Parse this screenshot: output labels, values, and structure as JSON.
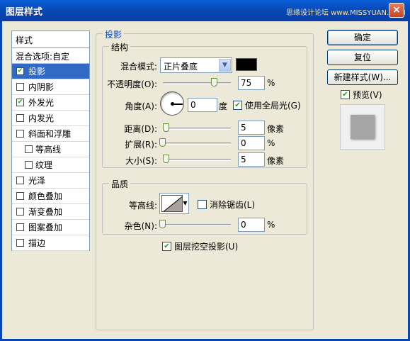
{
  "window": {
    "title": "图层样式",
    "watermark": "思缘设计论坛 www.MISSYUAN.COM",
    "close_glyph": "×"
  },
  "sidebar": {
    "header": "样式",
    "blend_options": "混合选项:自定",
    "items": [
      {
        "label": "投影",
        "checked": true,
        "selected": true
      },
      {
        "label": "内阴影",
        "checked": false
      },
      {
        "label": "外发光",
        "checked": true
      },
      {
        "label": "内发光",
        "checked": false
      },
      {
        "label": "斜面和浮雕",
        "checked": false
      },
      {
        "label": "等高线",
        "checked": false,
        "sub": true
      },
      {
        "label": "纹理",
        "checked": false,
        "sub": true
      },
      {
        "label": "光泽",
        "checked": false
      },
      {
        "label": "颜色叠加",
        "checked": false
      },
      {
        "label": "渐变叠加",
        "checked": false
      },
      {
        "label": "图案叠加",
        "checked": false
      },
      {
        "label": "描边",
        "checked": false
      }
    ]
  },
  "drop_shadow": {
    "title": "投影",
    "structure": {
      "title": "结构",
      "blend_mode_label": "混合模式:",
      "blend_mode_value": "正片叠底",
      "shadow_color": "#000000",
      "opacity_label": "不透明度(O):",
      "opacity_value": "75",
      "opacity_unit": "%",
      "opacity_level": 0.75,
      "angle_label": "角度(A):",
      "angle_value": "0",
      "angle_unit": "度",
      "global_light_label": "使用全局光(G)",
      "global_light_checked": true,
      "distance_label": "距离(D):",
      "distance_value": "5",
      "distance_unit": "像素",
      "spread_label": "扩展(R):",
      "spread_value": "0",
      "spread_unit": "%",
      "size_label": "大小(S):",
      "size_value": "5",
      "size_unit": "像素"
    },
    "quality": {
      "title": "品质",
      "contour_label": "等高线:",
      "anti_aliased_label": "消除锯齿(L)",
      "anti_aliased_checked": false,
      "noise_label": "杂色(N):",
      "noise_value": "0",
      "noise_unit": "%"
    },
    "knockout_label": "图层挖空投影(U)",
    "knockout_checked": true
  },
  "buttons": {
    "ok": "确定",
    "reset": "复位",
    "new_style": "新建样式(W)...",
    "preview_label": "预览(V)",
    "preview_checked": true
  },
  "check_glyph": "✔",
  "arrow_glyph": "▼"
}
